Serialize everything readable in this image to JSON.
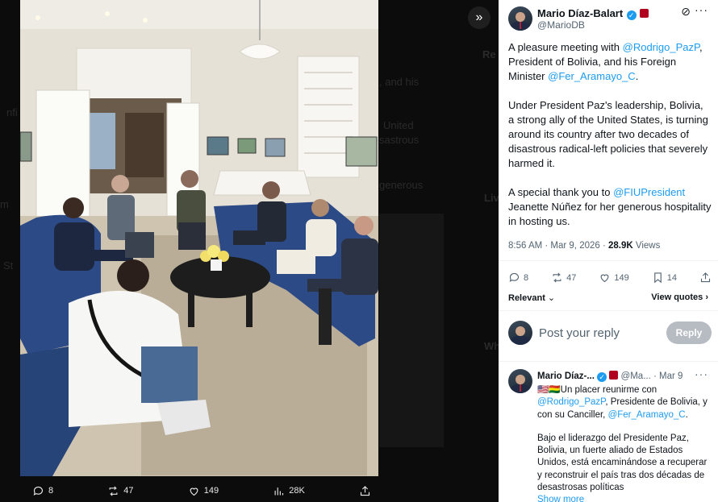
{
  "tweet": {
    "author_name": "Mario Díaz-Balart",
    "author_handle": "@MarioDB",
    "paragraph1": {
      "t1": "A pleasure meeting with ",
      "m1": "@Rodrigo_PazP",
      "t2": ", President of Bolivia, and his Foreign Minister ",
      "m2": "@Fer_Aramayo_C",
      "t3": "."
    },
    "paragraph2": "Under President Paz's leadership, Bolivia, a strong ally of the United States, is turning around its country after two decades of disastrous radical-left policies that severely harmed it.",
    "paragraph3": {
      "t1": "A special thank you to ",
      "m1": "@FIUPresident",
      "t2": " Jeanette Núñez for her generous hospitality in hosting us."
    },
    "timestamp": "8:56 AM · Mar 9, 2026 · ",
    "views_count": "28.9K",
    "views_label": " Views",
    "stats": {
      "replies": "8",
      "reposts": "47",
      "likes": "149",
      "bookmarks": "14"
    },
    "icons": {
      "reply": "reply-icon",
      "repost": "repost-icon",
      "like": "heart-icon",
      "bookmark": "bookmark-icon",
      "share": "share-icon"
    }
  },
  "sort": {
    "label": "Relevant",
    "view_quotes": "View quotes"
  },
  "compose": {
    "placeholder": "Post your reply",
    "button": "Reply"
  },
  "reply": {
    "author_name": "Mario Díaz-...",
    "handle": "@Ma...",
    "date": "· Mar 9",
    "flags": "🇺🇸🇧🇴",
    "p1": {
      "t1": "Un placer reunirme con ",
      "m1": "@Rodrigo_PazP",
      "t2": ", Presidente de Bolivia, y con su Canciller, ",
      "m2": "@Fer_Aramayo_C",
      "t3": "."
    },
    "p2": "Bajo el liderazgo del Presidente Paz, Bolivia, un fuerte aliado de Estados Unidos, está encaminándose a recuperar y reconstruir el país tras dos décadas de desastrosas políticas",
    "show_more": "Show more"
  },
  "media_bar": {
    "replies": "8",
    "reposts": "47",
    "likes": "149",
    "views": "28K"
  },
  "colors": {
    "accent": "#1d9bf0",
    "text": "#0f1419",
    "muted": "#536471"
  }
}
